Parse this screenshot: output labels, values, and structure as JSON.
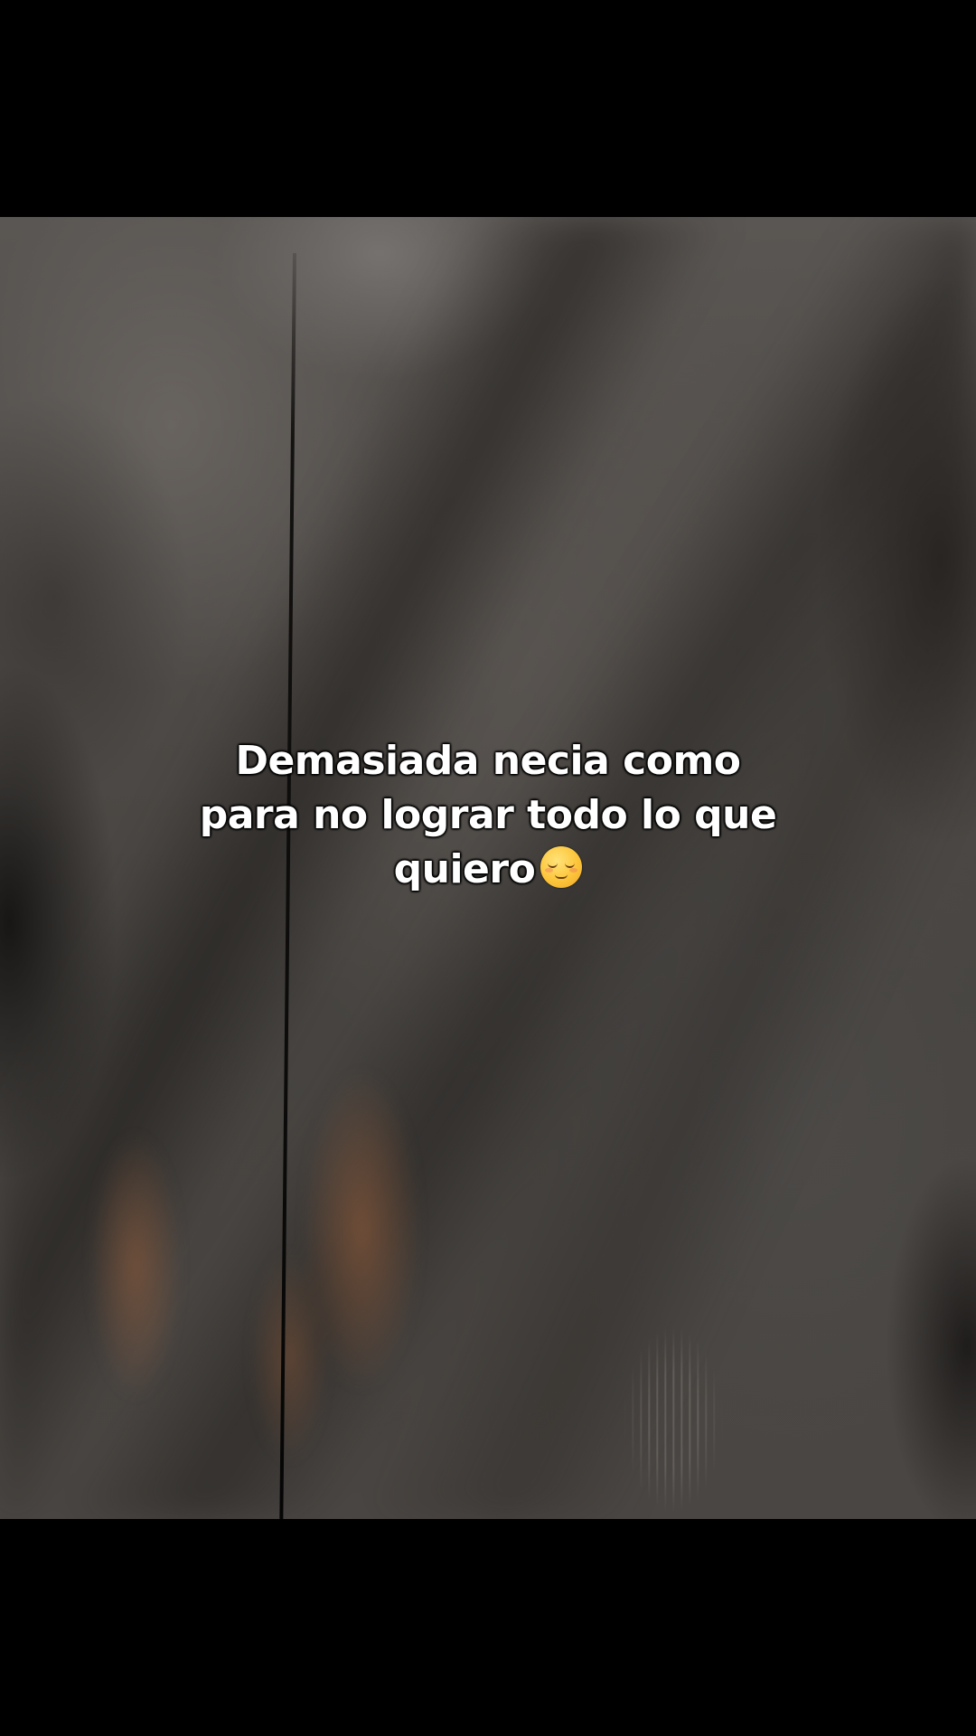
{
  "caption": {
    "line1": "Demasiada necia como",
    "line2": "para no lograr todo lo que",
    "line3": "quiero",
    "emoji_icon": "relieved-face-icon"
  }
}
